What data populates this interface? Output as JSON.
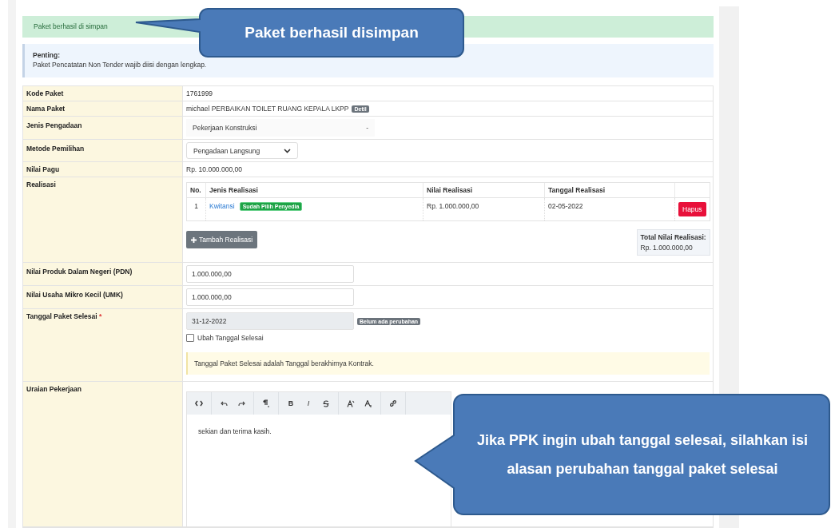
{
  "alert_success": "Paket berhasil di simpan",
  "info": {
    "title": "Penting:",
    "text": "Paket Pencatatan Non Tender wajib diisi dengan lengkap."
  },
  "form": {
    "kode_paket": {
      "label": "Kode Paket",
      "value": "1761999"
    },
    "nama_paket": {
      "label": "Nama Paket",
      "value": "michael PERBAIKAN TOILET RUANG KEPALA LKPP",
      "badge": "Detil"
    },
    "jenis_pengadaan": {
      "label": "Jenis Pengadaan",
      "value": "Pekerjaan Konstruksi",
      "caret": "-"
    },
    "metode_pemilihan": {
      "label": "Metode Pemilihan",
      "value": "Pengadaan Langsung"
    },
    "nilai_pagu": {
      "label": "Nilai Pagu",
      "value": "Rp. 10.000.000,00"
    },
    "realisasi": {
      "label": "Realisasi",
      "columns": [
        "No.",
        "Jenis Realisasi",
        "Nilai Realisasi",
        "Tanggal Realisasi"
      ],
      "rows": [
        {
          "no": "1",
          "jenis": "Kwitansi",
          "status": "Sudah Pilih Penyedia",
          "nilai": "Rp. 1.000.000,00",
          "tanggal": "02-05-2022",
          "action": "Hapus"
        }
      ],
      "add_button": "Tambah Realisasi",
      "total": {
        "label": "Total Nilai Realisasi:",
        "value": "Rp. 1.000.000,00"
      }
    },
    "pdn": {
      "label": "Nilai Produk Dalam Negeri (PDN)",
      "value": "1.000.000,00"
    },
    "umk": {
      "label": "Nilai Usaha Mikro Kecil (UMK)",
      "value": "1.000.000,00"
    },
    "tanggal_selesai": {
      "label": "Tanggal Paket Selesai",
      "required": "*",
      "value": "31-12-2022",
      "disabled": true,
      "badge": "Belum ada perubahan",
      "checkbox": {
        "label": "Ubah Tanggal Selesai",
        "checked": false
      },
      "note": "Tanggal Paket Selesai adalah Tanggal berakhirnya Kontrak."
    },
    "uraian": {
      "label": "Uraian Pekerjaan",
      "toolbar": [
        [
          {
            "kind": "code"
          }
        ],
        [
          {
            "kind": "undo"
          },
          {
            "kind": "redo"
          }
        ],
        [
          {
            "kind": "paragraph"
          }
        ],
        [
          {
            "kind": "bold",
            "label": "B"
          },
          {
            "kind": "italic",
            "label": "I"
          },
          {
            "kind": "strike"
          }
        ],
        [
          {
            "kind": "superscript"
          },
          {
            "kind": "subscript"
          }
        ],
        [
          {
            "kind": "link"
          }
        ]
      ],
      "content": "sekian dan terima kasih."
    }
  },
  "callouts": [
    {
      "text": "Paket berhasil disimpan"
    },
    {
      "text": "Jika PPK ingin ubah tanggal selesai, silahkan isi alasan perubahan tanggal paket selesai"
    }
  ]
}
